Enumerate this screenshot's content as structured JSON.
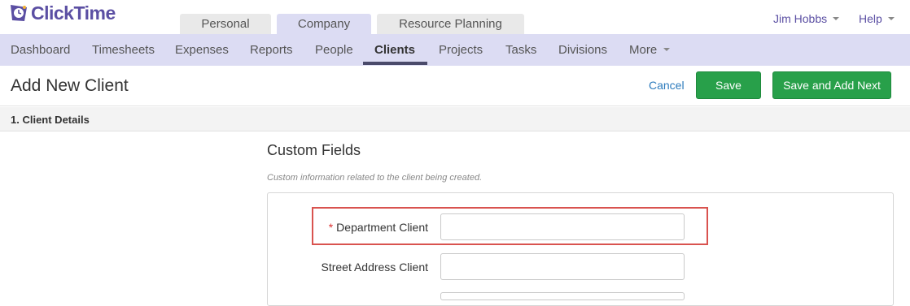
{
  "brand": {
    "name": "ClickTime"
  },
  "app_tabs": [
    {
      "label": "Personal"
    },
    {
      "label": "Company"
    },
    {
      "label": "Resource Planning"
    }
  ],
  "user_menu": {
    "label": "Jim Hobbs"
  },
  "help_menu": {
    "label": "Help"
  },
  "nav": {
    "items": [
      {
        "label": "Dashboard"
      },
      {
        "label": "Timesheets"
      },
      {
        "label": "Expenses"
      },
      {
        "label": "Reports"
      },
      {
        "label": "People"
      },
      {
        "label": "Clients"
      },
      {
        "label": "Projects"
      },
      {
        "label": "Tasks"
      },
      {
        "label": "Divisions"
      },
      {
        "label": "More"
      }
    ],
    "active": "Clients"
  },
  "page": {
    "title": "Add New Client",
    "cancel_label": "Cancel",
    "save_label": "Save",
    "save_next_label": "Save and Add Next"
  },
  "section": {
    "title": "1. Client Details"
  },
  "custom_fields": {
    "heading": "Custom Fields",
    "description": "Custom information related to the client being created.",
    "fields": [
      {
        "label": "Department Client",
        "required": "*",
        "value": ""
      },
      {
        "label": "Street Address Client",
        "value": ""
      }
    ]
  },
  "colors": {
    "brand_purple": "#5b4fa3",
    "nav_bg": "#dcdcf3",
    "button_green": "#28a04a",
    "link_blue": "#2d7bbd",
    "highlight_red": "#d9534f"
  }
}
